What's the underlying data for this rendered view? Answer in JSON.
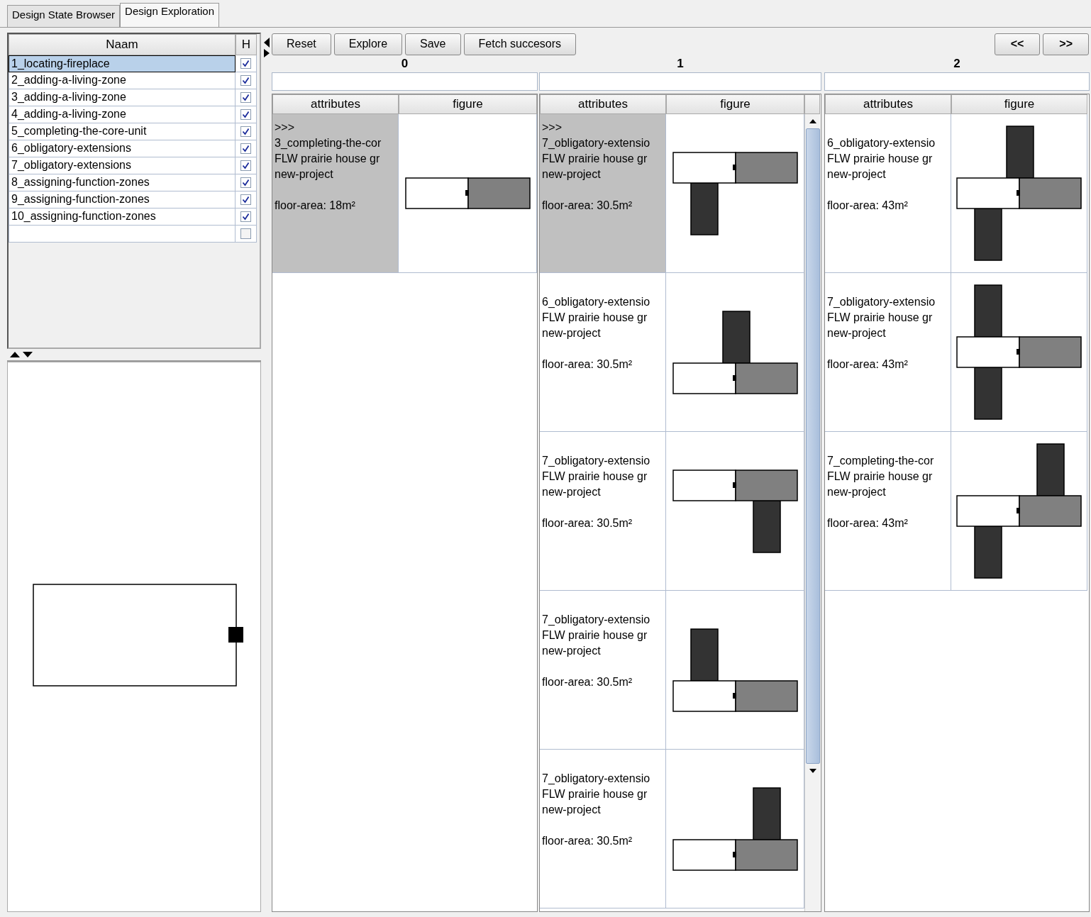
{
  "tabs": [
    {
      "label": "Design State Browser",
      "selected": false
    },
    {
      "label": "Design Exploration",
      "selected": true
    }
  ],
  "state_list": {
    "columns": [
      "Naam",
      "H"
    ],
    "rows": [
      {
        "name": "1_locating-fireplace",
        "checked": true,
        "selected": true
      },
      {
        "name": "2_adding-a-living-zone",
        "checked": true,
        "selected": false
      },
      {
        "name": "3_adding-a-living-zone",
        "checked": true,
        "selected": false
      },
      {
        "name": "4_adding-a-living-zone",
        "checked": true,
        "selected": false
      },
      {
        "name": "5_completing-the-core-unit",
        "checked": true,
        "selected": false
      },
      {
        "name": "6_obligatory-extensions",
        "checked": true,
        "selected": false
      },
      {
        "name": "7_obligatory-extensions",
        "checked": true,
        "selected": false
      },
      {
        "name": "8_assigning-function-zones",
        "checked": true,
        "selected": false
      },
      {
        "name": "9_assigning-function-zones",
        "checked": true,
        "selected": false
      },
      {
        "name": "10_assigning-function-zones",
        "checked": true,
        "selected": false
      },
      {
        "checked": false,
        "selected": false
      }
    ]
  },
  "toolbar": {
    "buttons": [
      "Reset",
      "Explore",
      "Save",
      "Fetch succesors"
    ],
    "nav_buttons": [
      "<<",
      ">>"
    ]
  },
  "columns": [
    {
      "index": "0",
      "table_columns": [
        "attributes",
        "figure"
      ],
      "scrollbar": false,
      "states": [
        {
          "selected": true,
          "marker": ">>>",
          "lines": [
            "3_completing-the-cor",
            "FLW prairie house gr",
            "new-project"
          ],
          "floor_area": "floor-area: 18m²",
          "kind": "core"
        }
      ]
    },
    {
      "index": "1",
      "table_columns": [
        "attributes",
        "figure"
      ],
      "scrollbar": true,
      "states": [
        {
          "selected": true,
          "marker": ">>>",
          "lines": [
            "7_obligatory-extensio",
            "FLW prairie house gr",
            "new-project"
          ],
          "floor_area": "floor-area: 30.5m²",
          "kind": "left-down"
        },
        {
          "selected": false,
          "lines": [
            "6_obligatory-extensio",
            "FLW prairie house gr",
            "new-project"
          ],
          "floor_area": "floor-area: 30.5m²",
          "kind": "mid-up"
        },
        {
          "selected": false,
          "lines": [
            "7_obligatory-extensio",
            "FLW prairie house gr",
            "new-project"
          ],
          "floor_area": "floor-area: 30.5m²",
          "kind": "right-down"
        },
        {
          "selected": false,
          "lines": [
            "7_obligatory-extensio",
            "FLW prairie house gr",
            "new-project"
          ],
          "floor_area": "floor-area: 30.5m²",
          "kind": "left-up"
        },
        {
          "selected": false,
          "lines": [
            "7_obligatory-extensio",
            "FLW prairie house gr",
            "new-project"
          ],
          "floor_area": "floor-area: 30.5m²",
          "kind": "right-up"
        }
      ]
    },
    {
      "index": "2",
      "table_columns": [
        "attributes",
        "figure"
      ],
      "scrollbar": false,
      "states": [
        {
          "selected": false,
          "lines": [
            "6_obligatory-extensio",
            "FLW prairie house gr",
            "new-project"
          ],
          "floor_area": "floor-area: 43m²",
          "kind": "mid-cross"
        },
        {
          "selected": false,
          "lines": [
            "7_obligatory-extensio",
            "FLW prairie house gr",
            "new-project"
          ],
          "floor_area": "floor-area: 43m²",
          "kind": "left-cross"
        },
        {
          "selected": false,
          "lines": [
            "7_completing-the-cor",
            "FLW prairie house gr",
            "new-project"
          ],
          "floor_area": "floor-area: 43m²",
          "kind": "right-cross"
        }
      ]
    }
  ]
}
